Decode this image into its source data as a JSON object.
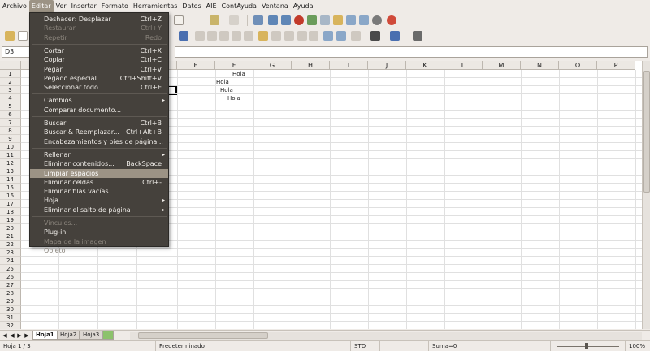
{
  "menubar": [
    "Archivo",
    "Editar",
    "Ver",
    "Insertar",
    "Formato",
    "Herramientas",
    "Datos",
    "AIE",
    "ContAyuda",
    "Ventana",
    "Ayuda"
  ],
  "namebox": "D3",
  "columns": [
    "E",
    "F",
    "G",
    "H",
    "I",
    "J",
    "K",
    "L",
    "M",
    "N",
    "O",
    "P"
  ],
  "rows": [
    "1",
    "2",
    "3",
    "4",
    "5",
    "6",
    "7",
    "8",
    "9",
    "10",
    "11",
    "12",
    "13",
    "14",
    "15",
    "16",
    "17",
    "18",
    "19",
    "20",
    "21",
    "22",
    "23",
    "24",
    "25",
    "26",
    "27",
    "28",
    "29",
    "30",
    "31",
    "32"
  ],
  "cells": {
    "f1": "Hola",
    "f2": "Hola",
    "f3": "Hola",
    "f4": "Hola"
  },
  "tabs": [
    "Hoja1",
    "Hoja2",
    "Hoja3"
  ],
  "status": {
    "page": "Hoja 1 / 3",
    "style": "Predeterminado",
    "mode": "STD",
    "sum": "Suma=0",
    "zoom": "100%"
  },
  "edit_menu": [
    {
      "label": "Deshacer: Desplazar",
      "shortcut": "Ctrl+Z",
      "disabled": false
    },
    {
      "label": "Restaurar",
      "shortcut": "Ctrl+Y",
      "disabled": true
    },
    {
      "label": "Repetir",
      "shortcut": "Redo",
      "disabled": true
    },
    {
      "label": "Cortar",
      "shortcut": "Ctrl+X",
      "disabled": false
    },
    {
      "label": "Copiar",
      "shortcut": "Ctrl+C",
      "disabled": false
    },
    {
      "label": "Pegar",
      "shortcut": "Ctrl+V",
      "disabled": false
    },
    {
      "label": "Pegado especial...",
      "shortcut": "Ctrl+Shift+V",
      "disabled": false
    },
    {
      "label": "Seleccionar todo",
      "shortcut": "Ctrl+E",
      "disabled": false
    },
    {
      "label": "Cambios",
      "shortcut": "",
      "disabled": false,
      "submenu": true
    },
    {
      "label": "Comparar documento...",
      "shortcut": "",
      "disabled": false
    },
    {
      "label": "Buscar",
      "shortcut": "Ctrl+B",
      "disabled": false
    },
    {
      "label": "Buscar & Reemplazar...",
      "shortcut": "Ctrl+Alt+B",
      "disabled": false
    },
    {
      "label": "Encabezamientos y pies de página...",
      "shortcut": "",
      "disabled": false
    },
    {
      "label": "Rellenar",
      "shortcut": "",
      "disabled": false,
      "submenu": true
    },
    {
      "label": "Eliminar contenidos...",
      "shortcut": "BackSpace",
      "disabled": false
    },
    {
      "label": "Limpiar espacios",
      "shortcut": "",
      "disabled": false,
      "highlight": true
    },
    {
      "label": "Eliminar celdas...",
      "shortcut": "Ctrl+-",
      "disabled": false
    },
    {
      "label": "Eliminar filas vacías",
      "shortcut": "",
      "disabled": false
    },
    {
      "label": "Hoja",
      "shortcut": "",
      "disabled": false,
      "submenu": true
    },
    {
      "label": "Eliminar el salto de página",
      "shortcut": "",
      "disabled": false,
      "submenu": true
    },
    {
      "label": "Vínculos...",
      "shortcut": "",
      "disabled": true
    },
    {
      "label": "Plug-in",
      "shortcut": "",
      "disabled": false
    },
    {
      "label": "Mapa de la imagen",
      "shortcut": "",
      "disabled": true
    },
    {
      "label": "Objeto",
      "shortcut": "",
      "disabled": true
    }
  ],
  "colors": {
    "menu_bg": "#45413c",
    "highlight": "#9c9385",
    "window_bg": "#efebe7"
  }
}
